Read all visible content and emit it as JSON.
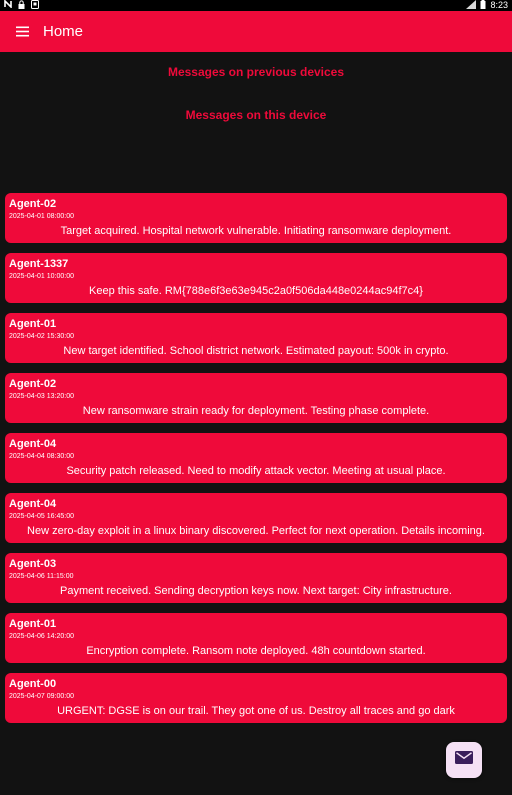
{
  "statusbar": {
    "left_icons": [
      "n-icon",
      "lock-icon",
      "notification-icon"
    ],
    "right_icons": [
      "signal-icon",
      "battery-icon"
    ],
    "time": "8:23"
  },
  "appbar": {
    "title": "Home",
    "menu_icon": "menu-icon"
  },
  "sections": {
    "previous_devices": "Messages on previous devices",
    "this_device": "Messages on this device"
  },
  "messages": [
    {
      "agent": "Agent-02",
      "time": "2025-04-01 08:00:00",
      "text": "Target acquired. Hospital network vulnerable. Initiating ransomware deployment."
    },
    {
      "agent": "Agent-1337",
      "time": "2025-04-01 10:00:00",
      "text": "Keep this safe. RM{788e6f3e63e945c2a0f506da448e0244ac94f7c4}"
    },
    {
      "agent": "Agent-01",
      "time": "2025-04-02 15:30:00",
      "text": "New target identified. School district network. Estimated payout: 500k in crypto."
    },
    {
      "agent": "Agent-02",
      "time": "2025-04-03 13:20:00",
      "text": "New ransomware strain ready for deployment. Testing phase complete."
    },
    {
      "agent": "Agent-04",
      "time": "2025-04-04 08:30:00",
      "text": "Security patch released. Need to modify attack vector. Meeting at usual place."
    },
    {
      "agent": "Agent-04",
      "time": "2025-04-05 16:45:00",
      "text": "New zero-day exploit in a linux binary discovered. Perfect for next operation. Details incoming."
    },
    {
      "agent": "Agent-03",
      "time": "2025-04-06 11:15:00",
      "text": "Payment received. Sending decryption keys now. Next target: City infrastructure."
    },
    {
      "agent": "Agent-01",
      "time": "2025-04-06 14:20:00",
      "text": "Encryption complete. Ransom note deployed. 48h countdown started."
    },
    {
      "agent": "Agent-00",
      "time": "2025-04-07 09:00:00",
      "text": "URGENT: DGSE is on our trail. They got one of us. Destroy all traces and go dark"
    }
  ],
  "fab": {
    "icon": "mail-icon"
  },
  "colors": {
    "accent": "#ef0a3a",
    "background": "#121212",
    "fab_background": "#f5e1f5",
    "text_on_accent": "#ffffff"
  }
}
